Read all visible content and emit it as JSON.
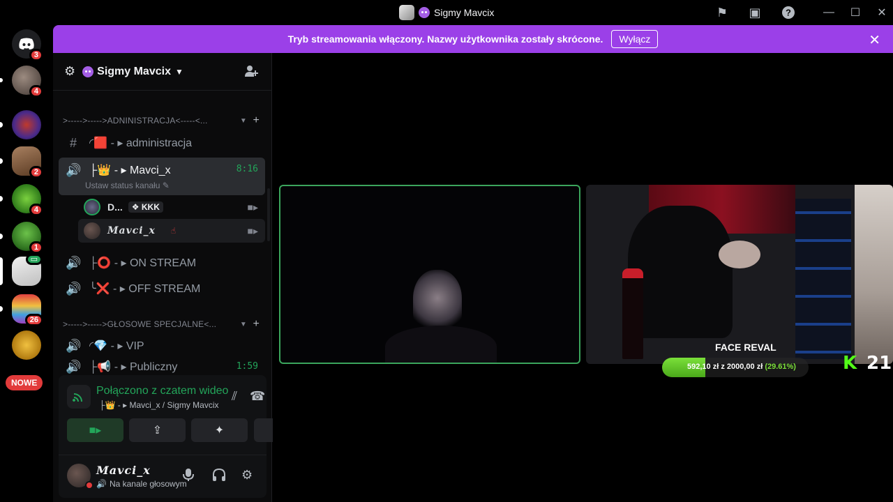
{
  "titlebar": {
    "title": "Sigmy Mavcix",
    "icons": [
      "flag-icon",
      "inbox-icon",
      "help-icon"
    ],
    "window": [
      "minimize",
      "maximize",
      "close"
    ]
  },
  "rail": {
    "servers": [
      {
        "name": "discord-home",
        "badge": "3",
        "color": "#5865f2"
      },
      {
        "name": "server-2",
        "badge": "4",
        "color": "#6b5d56"
      },
      {
        "name": "server-zakon",
        "badge": "",
        "color": "#4a2a8a"
      },
      {
        "name": "server-4",
        "badge": "2",
        "color": "#7a5a3a"
      },
      {
        "name": "server-5",
        "badge": "4",
        "color": "#3fa23f"
      },
      {
        "name": "server-6",
        "badge": "1",
        "color": "#3a8a3a"
      },
      {
        "name": "server-7",
        "badge": "",
        "color": "#d9d9d9"
      },
      {
        "name": "server-8",
        "badge": "26",
        "color": "#c9302c"
      },
      {
        "name": "server-9",
        "badge": "",
        "color": "#d7a22a"
      }
    ],
    "new_label": "NOWE"
  },
  "banner": {
    "text": "Tryb streamowania włączony. Nazwy użytkownika zostały skrócone.",
    "button": "Wyłącz"
  },
  "sidebar": {
    "server_name": "Sigmy Mavcix",
    "category_admin": ">----->----->ADNINISTRACJA<-----<...",
    "channel_admin": "◜🟥 - ▸ administracja",
    "channel_active": {
      "label": "├👑 - ▸ Mavci_x",
      "timer": "8:16",
      "status": "Ustaw status kanału"
    },
    "users": [
      {
        "name": "D...",
        "tag": "KKK"
      },
      {
        "name": "𝑴𝒂𝒗𝒄𝒊_𝒙",
        "tag": ""
      }
    ],
    "channel_on": "├⭕ - ▸ ON STREAM",
    "channel_off": "╰❌ - ▸ OFF STREAM",
    "category_special": ">----->----->GŁOSOWE SPECJALNE<...",
    "channel_vip": "◜💎 - ▸ VIP",
    "channel_public": {
      "label": "├📢 - ▸ Publiczny",
      "timer": "1:59"
    }
  },
  "voice_panel": {
    "status": "Połączono z czatem wideo",
    "path": "├👑 - ▸ Mavci_x / Sigmy Mavcix"
  },
  "user_bar": {
    "name": "𝑴𝒂𝒗𝒄𝒊_𝒙",
    "sub": "Na kanale głosowym"
  },
  "stream": {
    "overlay_title": "FACE REVAL",
    "progress_text": "592,10 zł z 2000,00 zł",
    "progress_pct": "(29.61%)",
    "progress_value": 0.2961,
    "kick_count": "21"
  },
  "colors": {
    "banner": "#9b40e8",
    "accent_green": "#23a55a",
    "badge_red": "#e23b3b"
  }
}
